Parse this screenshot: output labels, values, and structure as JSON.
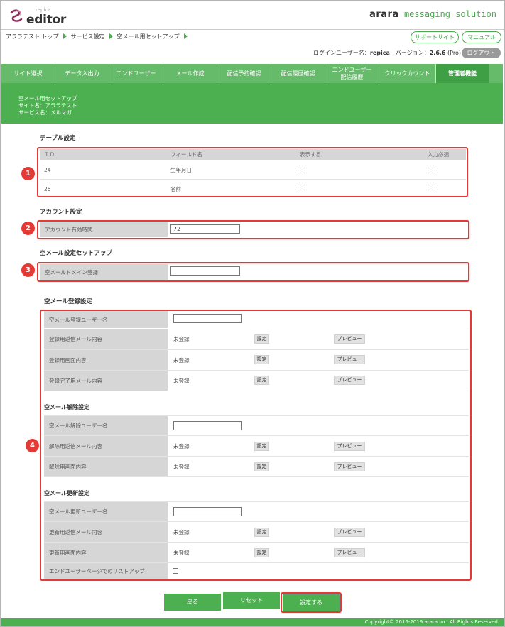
{
  "header": {
    "logo_small": "repica",
    "logo_big": "editor",
    "brand_a": "arara",
    "brand_b": " messaging solution",
    "support_label": "サポートサイト",
    "manual_label": "マニュアル",
    "login_user_prefix": "ログインユーザー名：",
    "login_user": "repica",
    "version_prefix": "　バージョン：",
    "version": "2.6.6",
    "version_suffix": " (Pro)",
    "logout_label": "ログアウト"
  },
  "breadcrumb": [
    "アララテスト トップ",
    "サービス設定",
    "空メール用セットアップ"
  ],
  "nav": {
    "tabs": [
      "サイト選択",
      "データ入出力",
      "エンドユーザー",
      "メール作成",
      "配信予約確認",
      "配信履歴確認"
    ],
    "tab_enduser_line1": "エンドユーザー",
    "tab_enduser_line2": "配信履歴",
    "tab_click": "クリックカウント",
    "tab_admin": "管理者機能"
  },
  "banner": {
    "line1": "空メール用セットアップ",
    "line2": "サイト名：アララテスト",
    "line3": "サービス名：メルマガ"
  },
  "badges": [
    "1",
    "2",
    "3",
    "4"
  ],
  "table_settings": {
    "title": "テーブル設定",
    "headers": [
      "ＩＤ",
      "フィールド名",
      "表示する",
      "入力必須"
    ],
    "rows": [
      {
        "id": "24",
        "field": "生年月日"
      },
      {
        "id": "25",
        "field": "名前"
      }
    ]
  },
  "account_settings": {
    "title": "アカウント設定",
    "label": "アカウント有効時間",
    "value": "72"
  },
  "empty_mail_setup": {
    "title": "空メール設定セットアップ",
    "label": "空メールドメイン登録",
    "value": ""
  },
  "register": {
    "title": "空メール登録設定",
    "user_label": "空メール登録ユーザー名",
    "rows": [
      {
        "label": "登録用返信メール内容",
        "status": "未登録"
      },
      {
        "label": "登録用画面内容",
        "status": "未登録"
      },
      {
        "label": "登録完了用メール内容",
        "status": "未登録"
      }
    ]
  },
  "cancel": {
    "title": "空メール解除設定",
    "user_label": "空メール解除ユーザー名",
    "rows": [
      {
        "label": "解除用返信メール内容",
        "status": "未登録"
      },
      {
        "label": "解除用画面内容",
        "status": "未登録"
      }
    ]
  },
  "update": {
    "title": "空メール更新設定",
    "user_label": "空メール更新ユーザー名",
    "rows": [
      {
        "label": "更新用返信メール内容",
        "status": "未登録"
      },
      {
        "label": "更新用画面内容",
        "status": "未登録"
      }
    ],
    "list_label": "エンドユーザーページでのリストアップ"
  },
  "buttons": {
    "set": "設定",
    "preview": "プレビュー",
    "back": "戻る",
    "reset": "リセット",
    "submit": "設定する"
  },
  "footer": "Copyright© 2016-2019 arara inc. All Rights Reserved.",
  "colors": {
    "green": "#4caf50",
    "nav_green": "#66bb6a",
    "active_tab": "#3f9f45",
    "highlight_red": "#e53935"
  }
}
